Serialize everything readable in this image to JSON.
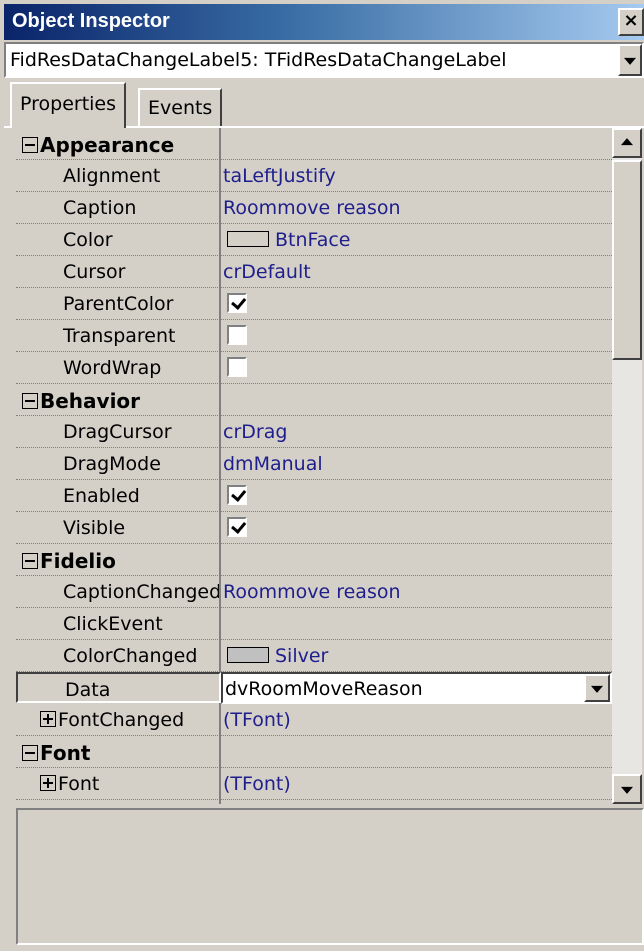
{
  "window": {
    "title": "Object Inspector",
    "close_glyph": "×"
  },
  "object_selector": {
    "value": "FidResDataChangeLabel5: TFidResDataChangeLabel"
  },
  "tabs": [
    {
      "label": "Properties",
      "active": true
    },
    {
      "label": "Events",
      "active": false
    }
  ],
  "properties": [
    {
      "kind": "category",
      "name": "Appearance",
      "expanded": true
    },
    {
      "kind": "prop",
      "name": "Alignment",
      "value": "taLeftJustify"
    },
    {
      "kind": "prop",
      "name": "Caption",
      "value": "Roommove reason"
    },
    {
      "kind": "color",
      "name": "Color",
      "value": "BtnFace",
      "swatch": "#d4d0c8"
    },
    {
      "kind": "prop",
      "name": "Cursor",
      "value": "crDefault"
    },
    {
      "kind": "bool",
      "name": "ParentColor",
      "checked": true
    },
    {
      "kind": "bool",
      "name": "Transparent",
      "checked": false
    },
    {
      "kind": "bool",
      "name": "WordWrap",
      "checked": false
    },
    {
      "kind": "category",
      "name": "Behavior",
      "expanded": true
    },
    {
      "kind": "prop",
      "name": "DragCursor",
      "value": "crDrag"
    },
    {
      "kind": "prop",
      "name": "DragMode",
      "value": "dmManual"
    },
    {
      "kind": "bool",
      "name": "Enabled",
      "checked": true
    },
    {
      "kind": "bool",
      "name": "Visible",
      "checked": true
    },
    {
      "kind": "category",
      "name": "Fidelio",
      "expanded": true
    },
    {
      "kind": "prop",
      "name": "CaptionChanged",
      "value": "Roommove reason"
    },
    {
      "kind": "prop",
      "name": "ClickEvent",
      "value": ""
    },
    {
      "kind": "color",
      "name": "ColorChanged",
      "value": "Silver",
      "swatch": "#c0c0c0"
    },
    {
      "kind": "selected",
      "name": "Data",
      "value": "dvRoomMoveReason"
    },
    {
      "kind": "subprop",
      "name": "FontChanged",
      "value": "(TFont)",
      "expanded": false
    },
    {
      "kind": "category",
      "name": "Font",
      "expanded": true
    },
    {
      "kind": "subprop",
      "name": "Font",
      "value": "(TFont)",
      "expanded": false
    }
  ],
  "colors": {
    "title_start": "#0a246a",
    "title_end": "#a6caf0",
    "face": "#d4d0c8",
    "value_text": "#1e1e8c"
  }
}
